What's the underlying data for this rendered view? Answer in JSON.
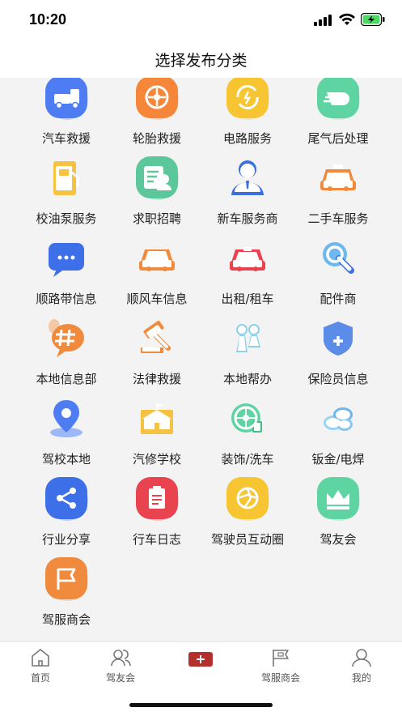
{
  "status_bar": {
    "time": "10:20"
  },
  "header": {
    "title": "选择发布分类"
  },
  "categories": [
    {
      "label": "汽车救援",
      "icon": "tow-truck-icon",
      "color": "#4d7cf3"
    },
    {
      "label": "轮胎救援",
      "icon": "tire-icon",
      "color": "#f5863a"
    },
    {
      "label": "电路服务",
      "icon": "circuit-refresh-icon",
      "color": "#f7c531"
    },
    {
      "label": "尾气后处理",
      "icon": "exhaust-icon",
      "color": "#5ed4a3"
    },
    {
      "label": "校油泵服务",
      "icon": "fuel-pump-icon",
      "color": "#f5c242"
    },
    {
      "label": "求职招聘",
      "icon": "job-resume-icon",
      "color": "#5bc79a"
    },
    {
      "label": "新车服务商",
      "icon": "dealer-person-icon",
      "color": "#3b6fe0"
    },
    {
      "label": "二手车服务",
      "icon": "used-car-icon",
      "color": "#f08a3c"
    },
    {
      "label": "顺路带信息",
      "icon": "chat-bubble-icon",
      "color": "#3d6fe8"
    },
    {
      "label": "顺风车信息",
      "icon": "car-icon",
      "color": "#f08a3c"
    },
    {
      "label": "出租/租车",
      "icon": "taxi-icon",
      "color": "#e8434f"
    },
    {
      "label": "配件商",
      "icon": "wrench-gear-icon",
      "color": "#3d6fe8"
    },
    {
      "label": "本地信息部",
      "icon": "hashtag-bubble-icon",
      "color": "#f08a3c"
    },
    {
      "label": "法律救援",
      "icon": "gavel-icon",
      "color": "#f08a3c"
    },
    {
      "label": "本地帮办",
      "icon": "couple-icon",
      "color": "#8fd0e6"
    },
    {
      "label": "保险员信息",
      "icon": "shield-plus-icon",
      "color": "#5a8ce8"
    },
    {
      "label": "驾校本地",
      "icon": "location-pin-icon",
      "color": "#4d7cf3"
    },
    {
      "label": "汽修学校",
      "icon": "school-building-icon",
      "color": "#f5c242"
    },
    {
      "label": "装饰/洗车",
      "icon": "wheel-wash-icon",
      "color": "#5ed4a3"
    },
    {
      "label": "钣金/电焊",
      "icon": "sheet-metal-icon",
      "color": "#6cb8ef"
    },
    {
      "label": "行业分享",
      "icon": "share-icon",
      "color": "#3d6fe8"
    },
    {
      "label": "行车日志",
      "icon": "clipboard-icon",
      "color": "#e8434f"
    },
    {
      "label": "驾驶员互动圈",
      "icon": "aperture-icon",
      "color": "#f7c531"
    },
    {
      "label": "驾友会",
      "icon": "crown-icon",
      "color": "#5ed4a3"
    },
    {
      "label": "驾服商会",
      "icon": "flag-icon",
      "color": "#f08a3c"
    }
  ],
  "tabbar": [
    {
      "label": "首页",
      "icon": "home-icon"
    },
    {
      "label": "驾友会",
      "icon": "friends-icon"
    },
    {
      "label": "",
      "icon": "add-icon"
    },
    {
      "label": "驾服商会",
      "icon": "chamber-flag-icon"
    },
    {
      "label": "我的",
      "icon": "profile-icon"
    }
  ]
}
